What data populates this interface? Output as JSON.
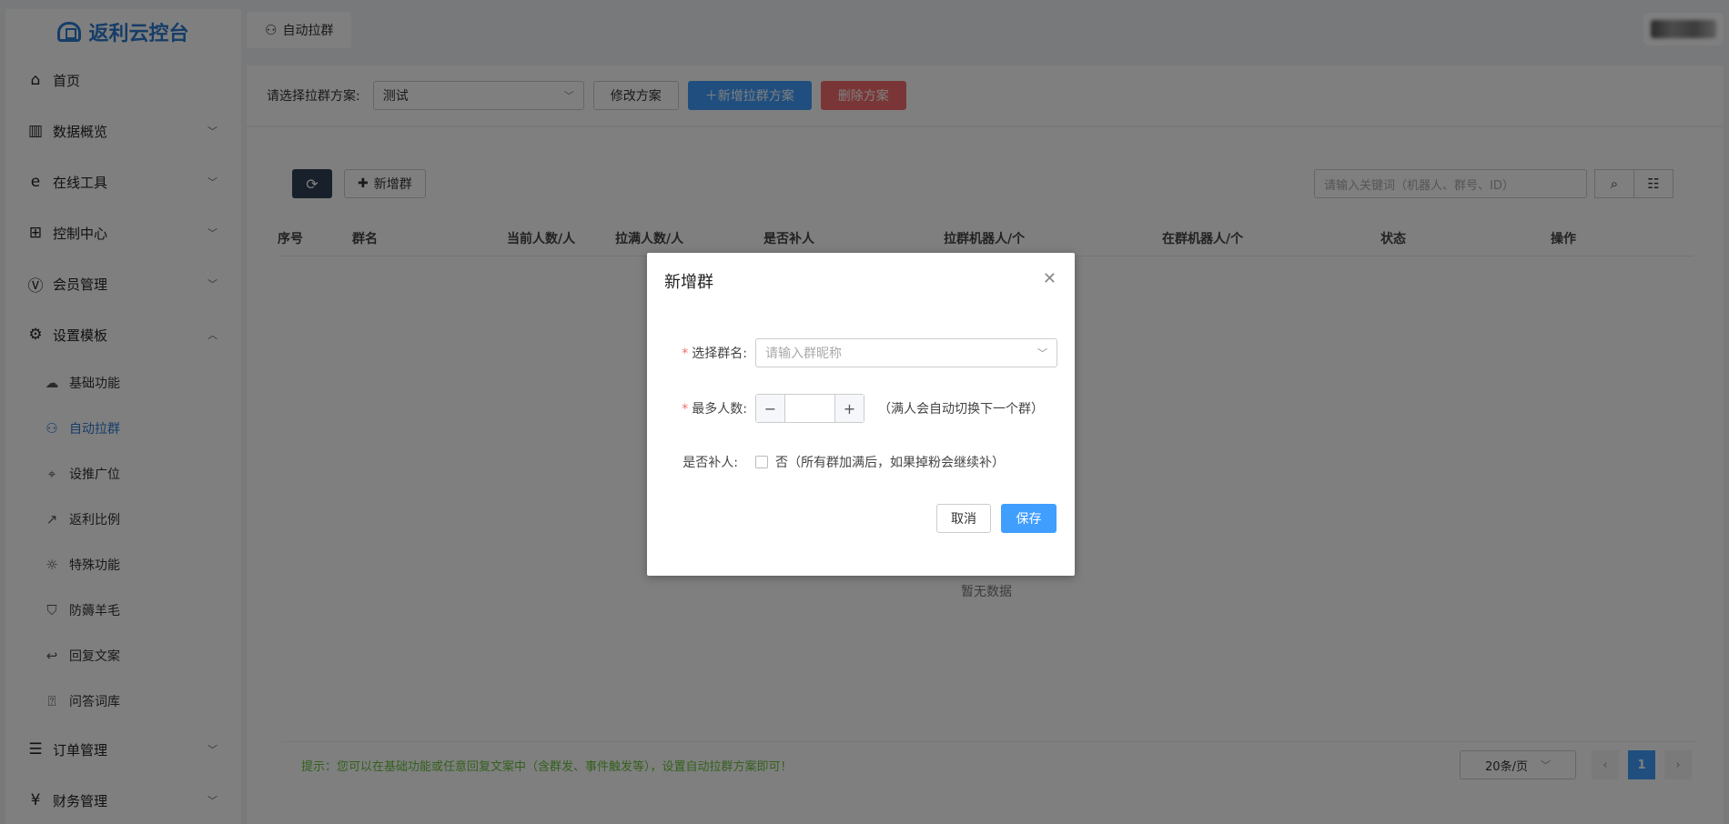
{
  "app": {
    "title": "返利云控台"
  },
  "sidebar": {
    "items": [
      {
        "label": "首页",
        "icon": "home-icon",
        "glyph": "⌂",
        "chev": ""
      },
      {
        "label": "数据概览",
        "icon": "bar-chart-icon",
        "glyph": "▥",
        "chev": "﹀"
      },
      {
        "label": "在线工具",
        "icon": "ie-icon",
        "glyph": "e",
        "chev": "﹀"
      },
      {
        "label": "控制中心",
        "icon": "windows-icon",
        "glyph": "⊞",
        "chev": "﹀"
      },
      {
        "label": "会员管理",
        "icon": "vip-icon",
        "glyph": "Ⓥ",
        "chev": "﹀"
      },
      {
        "label": "设置模板",
        "icon": "gear-icon",
        "glyph": "⚙",
        "chev": "︿"
      }
    ],
    "sub_items": [
      {
        "label": "基础功能",
        "icon": "cloud-icon",
        "glyph": "☁"
      },
      {
        "label": "自动拉群",
        "icon": "users-icon",
        "glyph": "⚇"
      },
      {
        "label": "设推广位",
        "icon": "location-icon",
        "glyph": "⌖"
      },
      {
        "label": "返利比例",
        "icon": "share-icon",
        "glyph": "↗"
      },
      {
        "label": "特殊功能",
        "icon": "bulb-icon",
        "glyph": "☼"
      },
      {
        "label": "防薅羊毛",
        "icon": "shield-icon",
        "glyph": "⛉"
      },
      {
        "label": "回复文案",
        "icon": "reply-icon",
        "glyph": "↩"
      },
      {
        "label": "问答词库",
        "icon": "question-icon",
        "glyph": "⍰"
      }
    ],
    "bottom_items": [
      {
        "label": "订单管理",
        "icon": "list-icon",
        "glyph": "☰",
        "chev": "﹀"
      },
      {
        "label": "财务管理",
        "icon": "yen-icon",
        "glyph": "¥",
        "chev": "﹀"
      }
    ]
  },
  "topbar": {
    "tab_label": "自动拉群"
  },
  "planbar": {
    "label": "请选择拉群方案:",
    "selected": "测试",
    "edit_label": "修改方案",
    "add_label": "＋新增拉群方案",
    "delete_label": "删除方案"
  },
  "toolbar": {
    "add_group_label": "新增群",
    "search_placeholder": "请输入关键词（机器人、群号、ID）"
  },
  "table": {
    "columns": [
      "序号",
      "群名",
      "当前人数/人",
      "拉满人数/人",
      "是否补人",
      "拉群机器人/个",
      "在群机器人/个",
      "状态",
      "操作"
    ],
    "empty_text": "暂无数据"
  },
  "footer": {
    "tip": "提示：您可以在基础功能或任意回复文案中（含群发、事件触发等），设置自动拉群方案即可！",
    "page_size": "20条/页",
    "current_page": "1"
  },
  "modal": {
    "title": "新增群",
    "group_name_label": "选择群名:",
    "group_name_placeholder": "请输入群昵称",
    "max_label": "最多人数:",
    "max_hint": "（满人会自动切换下一个群）",
    "refill_label": "是否补人:",
    "refill_option": "否（所有群加满后，如果掉粉会继续补）",
    "cancel_label": "取消",
    "save_label": "保存"
  }
}
